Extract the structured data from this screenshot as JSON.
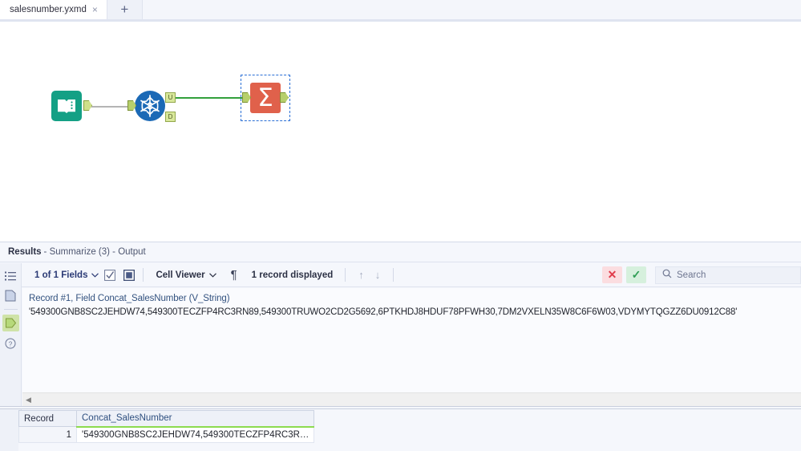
{
  "tabs": [
    {
      "label": "salesnumber.yxmd",
      "close": "×"
    }
  ],
  "new_tab_label": "+",
  "canvas": {
    "nodes": [
      {
        "name": "input-data-tool",
        "type": "book"
      },
      {
        "name": "unique-tool",
        "type": "snowflake",
        "ports": [
          "U",
          "D"
        ]
      },
      {
        "name": "summarize-tool",
        "type": "sigma",
        "glyph": "Σ",
        "selected": true
      }
    ]
  },
  "results": {
    "title_bold": "Results",
    "title_rest": "- Summarize (3) - Output",
    "rail": [
      {
        "name": "list-view-icon",
        "active": false
      },
      {
        "name": "metadata-icon",
        "active": false
      },
      {
        "name": "output-anchor-icon",
        "active": true
      },
      {
        "name": "help-icon",
        "active": false
      }
    ],
    "toolbar": {
      "fields_label": "1 of 1 Fields",
      "fields_chevron": "⌄",
      "check_icon": "select-all-icon",
      "uncheck_icon": "deselect-all-icon",
      "cell_viewer_label": "Cell Viewer",
      "cell_viewer_chevron": "⌄",
      "pilcrow": "¶",
      "record_count_label": "1 record displayed",
      "up_arrow": "↑",
      "down_arrow": "↓",
      "cancel_label": "✕",
      "confirm_label": "✓",
      "search_placeholder": "Search",
      "search_value": ""
    },
    "cell_viewer": {
      "header": "Record #1, Field Concat_SalesNumber (V_String)",
      "value": "'549300GNB8SC2JEHDW74,549300TECZFP4RC3RN89,549300TRUWO2CD2G5692,6PTKHDJ8HDUF78PFWH30,7DM2VXELN35W8C6F6W03,VDYMYTQGZZ6DU0912C88'"
    },
    "grid": {
      "columns": [
        "Record",
        "Concat_SalesNumber"
      ],
      "rows": [
        {
          "record": "1",
          "value": "'549300GNB8SC2JEHDW74,549300TECZFP4RC3R…"
        }
      ]
    },
    "scroll_left_arrow": "◀"
  },
  "colors": {
    "accent_blue": "#2b3a75",
    "input_tool": "#14a085",
    "unique_tool": "#1b69b6",
    "summarize_tool": "#e0614b",
    "wire_green": "#33a03c",
    "wire_grey": "#b4b4b4",
    "selection_border": "#2a6fd6",
    "field_underline": "#8ddb4f",
    "cancel_bg": "#fbdde0",
    "confirm_bg": "#d6f0dd"
  }
}
